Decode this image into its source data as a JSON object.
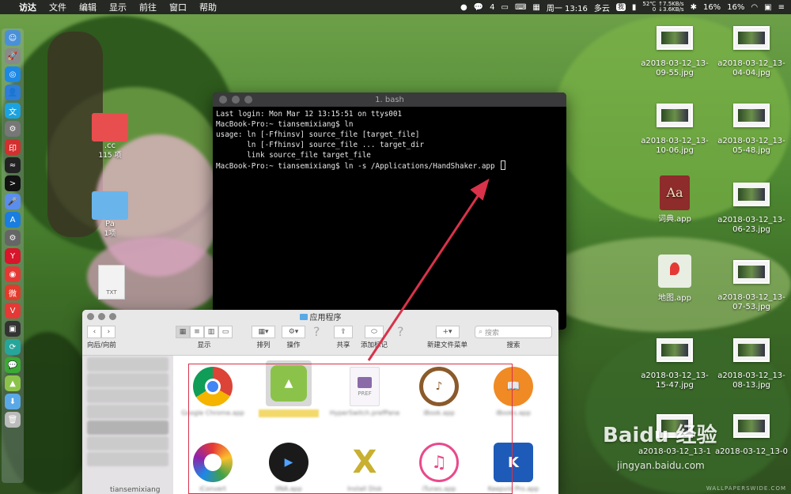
{
  "menubar": {
    "apple": "",
    "app_name": "访达",
    "items": [
      "文件",
      "编辑",
      "显示",
      "前往",
      "窗口",
      "帮助"
    ],
    "wechat_count": "4",
    "clock": "周一 13:16",
    "weather": "多云",
    "weather_temp": "我",
    "temp": "52℃",
    "net_up": "↑7.5KB/s",
    "net_down": "↓3.6KB/s",
    "net_zero": "0",
    "battery1": "16%",
    "battery2": "16%"
  },
  "terminal": {
    "title": "1. bash",
    "lines": [
      "Last login: Mon Mar 12 13:15:51 on ttys001",
      "MacBook-Pro:~ tiansemixiang$ ln",
      "usage: ln [-Ffhinsv] source_file [target_file]",
      "       ln [-Ffhinsv] source_file ... target_dir",
      "       link source_file target_file",
      "MacBook-Pro:~ tiansemixiang$ ln -s /Applications/HandShaker.app "
    ]
  },
  "finder": {
    "title": "应用程序",
    "toolbar": {
      "back_forward": "向后/向前",
      "view": "显示",
      "arrange": "排列",
      "action": "操作",
      "share": "共享",
      "tags": "添加标记",
      "new_folder_menu": "新建文件菜单",
      "search": "搜索",
      "search_placeholder": "搜索"
    },
    "sidebar_label": "tiansemixiang",
    "apps_row1": [
      {
        "label": "Google Chrome.app",
        "icon": "chrome-icon",
        "color": "#db4437"
      },
      {
        "label": "",
        "icon": "android-icon",
        "color": "#8bc34a"
      },
      {
        "label": "HyperSwitch.prefPane",
        "icon": "pref-icon",
        "color": "#9c7fb8",
        "pref": "PREF"
      },
      {
        "label": "iBook.app",
        "icon": "ibooks-icon",
        "color": "#8b5a2b"
      },
      {
        "label": "iBooks.app",
        "icon": "book-icon",
        "color": "#f08a24"
      }
    ],
    "apps_row2": [
      {
        "label": "iConvert",
        "icon": "iconvert-icon",
        "color": "#3cb371"
      },
      {
        "label": "IINA.app",
        "icon": "iina-icon",
        "color": "#1a1a1a"
      },
      {
        "label": "Install Disk",
        "icon": "install-icon",
        "color": "#b8a232"
      },
      {
        "label": "iTunes.app",
        "icon": "itunes-icon",
        "color": "#e94a8c"
      },
      {
        "label": "Keepvid Pro.app",
        "icon": "keepvid-icon",
        "color": "#1e5bb8",
        "letter": "K"
      }
    ]
  },
  "desktop": {
    "left_items": [
      {
        "label": ".cc",
        "sub": "115 项"
      },
      {
        "label": "Pa",
        "sub": "1项"
      },
      {
        "label": "",
        "sub": "TXT"
      }
    ],
    "right_col1": [
      "a2018-03-12_13-09-55.jpg",
      "a2018-03-12_13-10-06.jpg",
      "词典.app",
      "地图.app",
      "a2018-03-12_13-15-47.jpg",
      "a2018-03-12_13-1"
    ],
    "right_col2": [
      "a2018-03-12_13-04-04.jpg",
      "a2018-03-12_13-05-48.jpg",
      "a2018-03-12_13-06-23.jpg",
      "a2018-03-12_13-07-53.jpg",
      "a2018-03-12_13-08-13.jpg",
      "a2018-03-12_13-0"
    ],
    "dict_glyph": "Aa"
  },
  "watermark": {
    "brand": "Baidu 经验",
    "site": "jingyan.baidu.com",
    "corner": "WALLPAPERSWIDE.COM"
  }
}
